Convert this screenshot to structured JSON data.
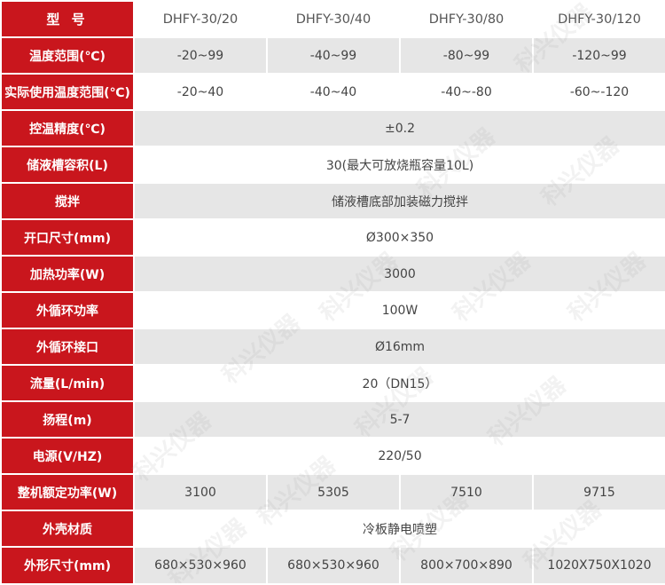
{
  "colors": {
    "header_red": "#c9161d",
    "zebra_gray": "#e6e6e6",
    "text_gray": "#444444"
  },
  "header": {
    "title": "型 号",
    "models": [
      "DHFY-30/20",
      "DHFY-30/40",
      "DHFY-30/80",
      "DHFY-30/120"
    ]
  },
  "rows": [
    {
      "label": "温度范围(℃)",
      "values": [
        "-20~99",
        "-40~99",
        "-80~99",
        "-120~99"
      ]
    },
    {
      "label": "实际使用温度范围(℃)",
      "values": [
        "-20~40",
        "-40~40",
        "-40~-80",
        "-60~-120"
      ]
    },
    {
      "label": "控温精度(℃)",
      "value": "±0.2"
    },
    {
      "label": "储液槽容积(L)",
      "value": "30(最大可放烧瓶容量10L)"
    },
    {
      "label": "搅拌",
      "value": "储液槽底部加装磁力搅拌"
    },
    {
      "label": "开口尺寸(mm)",
      "value": "Ø300×350"
    },
    {
      "label": "加热功率(W)",
      "value": "3000"
    },
    {
      "label": "外循环功率",
      "value": "100W"
    },
    {
      "label": "外循环接口",
      "value": "Ø16mm"
    },
    {
      "label": "流量(L/min)",
      "value": "20（DN15）"
    },
    {
      "label": "扬程(m)",
      "value": "5-7"
    },
    {
      "label": "电源(V/HZ)",
      "value": "220/50"
    },
    {
      "label": "整机额定功率(W)",
      "values": [
        "3100",
        "5305",
        "7510",
        "9715"
      ]
    },
    {
      "label": "外壳材质",
      "value": "冷板静电喷塑"
    },
    {
      "label": "外形尺寸(mm)",
      "values": [
        "680×530×960",
        "680×530×960",
        "800×700×890",
        "1020X750X1020"
      ]
    }
  ],
  "watermark": {
    "text": "科兴仪器"
  }
}
